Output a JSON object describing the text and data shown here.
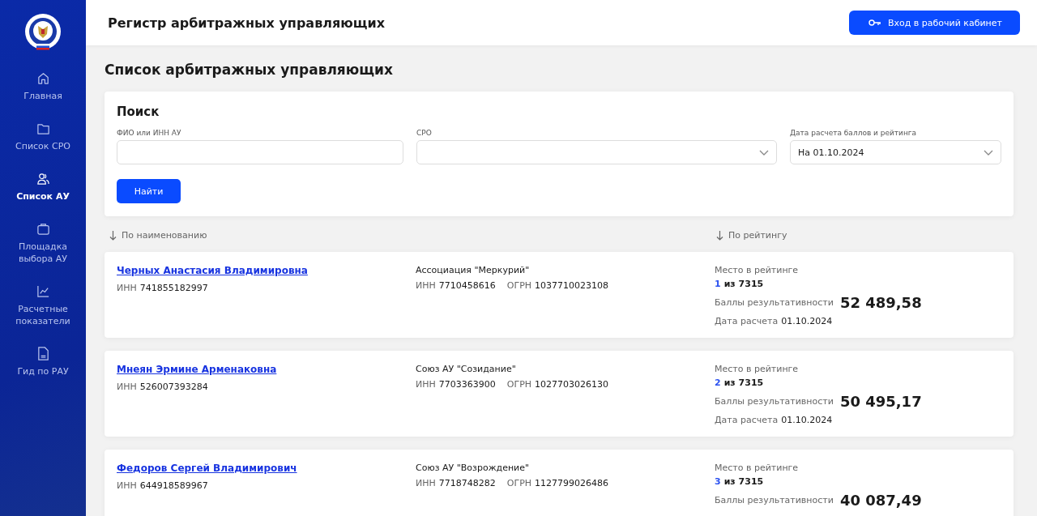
{
  "header": {
    "title": "Регистр арбитражных управляющих",
    "login_button": "Вход в рабочий кабинет"
  },
  "sidebar": {
    "items": [
      {
        "label": "Главная",
        "selected": false
      },
      {
        "label": "Список СРО",
        "selected": false
      },
      {
        "label": "Список АУ",
        "selected": true
      },
      {
        "label": "Площадка выбора АУ",
        "selected": false
      },
      {
        "label": "Расчетные показатели",
        "selected": false
      },
      {
        "label": "Гид по РАУ",
        "selected": false
      }
    ]
  },
  "page_title": "Список арбитражных управляющих",
  "search": {
    "title": "Поиск",
    "fields": [
      {
        "kind": "text",
        "label": "ФИО или ИНН АУ"
      },
      {
        "kind": "select",
        "label": "СРО"
      },
      {
        "kind": "select",
        "label": "Дата расчета баллов и рейтинга",
        "value": "На 01.10.2024"
      }
    ],
    "button": "Найти"
  },
  "sort": {
    "by_name": "По наименованию",
    "by_rating": "По рейтингу"
  },
  "managers": [
    {
      "name": "Черных Анастасия Владимировна",
      "inn_label": "ИНН",
      "inn": "741855182997",
      "sro": "Ассоциация \"Меркурий\"",
      "sro_inn_label": "ИНН",
      "sro_inn": "7710458616",
      "ogrn_label": "ОГРН",
      "ogrn": "1037710023108",
      "rank_label": "Место в рейтинге",
      "rank": "1",
      "rank_total": "из 7315",
      "score_label": "Баллы результативности",
      "score": "52 489,58",
      "date_label": "Дата расчета",
      "date": "01.10.2024"
    },
    {
      "name": "Мнеян Эрмине Арменаковна",
      "inn_label": "ИНН",
      "inn": "526007393284",
      "sro": "Союз АУ \"Созидание\"",
      "sro_inn_label": "ИНН",
      "sro_inn": "7703363900",
      "ogrn_label": "ОГРН",
      "ogrn": "1027703026130",
      "rank_label": "Место в рейтинге",
      "rank": "2",
      "rank_total": "из 7315",
      "score_label": "Баллы результативности",
      "score": "50 495,17",
      "date_label": "Дата расчета",
      "date": "01.10.2024"
    },
    {
      "name": "Федоров Сергей Владимирович",
      "inn_label": "ИНН",
      "inn": "644918589967",
      "sro": "Союз АУ \"Возрождение\"",
      "sro_inn_label": "ИНН",
      "sro_inn": "7718748282",
      "ogrn_label": "ОГРН",
      "ogrn": "1127799026486",
      "rank_label": "Место в рейтинге",
      "rank": "3",
      "rank_total": "из 7315",
      "score_label": "Баллы результативности",
      "score": "40 087,49"
    }
  ]
}
